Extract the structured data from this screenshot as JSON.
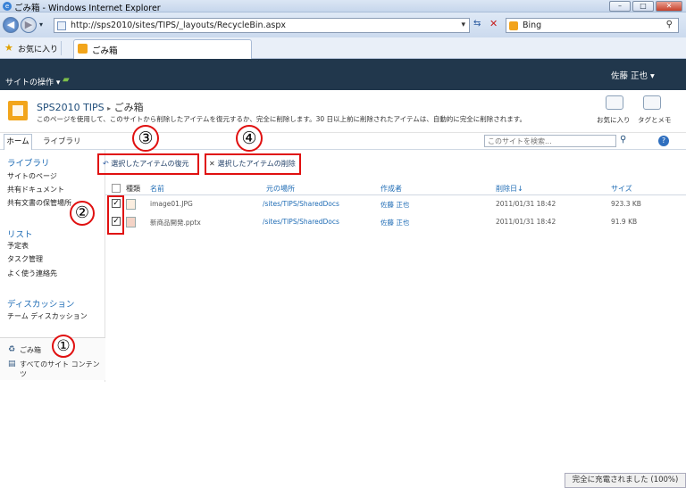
{
  "window": {
    "title": "ごみ箱 - Windows Internet Explorer"
  },
  "addressbar": {
    "url": "http://sps2010/sites/TIPS/_layouts/RecycleBin.aspx",
    "search_engine": "Bing"
  },
  "favorites_bar": {
    "favorites_label": "お気に入り",
    "tab_title": "ごみ箱"
  },
  "sp_header": {
    "site_actions": "サイトの操作",
    "user": "佐藤 正也"
  },
  "title_area": {
    "site_name": "SPS2010 TIPS",
    "page_name": "ごみ箱",
    "description": "このページを使用して、このサイトから削除したアイテムを復元するか、完全に削除します。30 日以上前に削除されたアイテムは、自動的に完全に削除されます。",
    "favorite_label": "お気に入り",
    "tags_label": "タグとメモ"
  },
  "tabs": {
    "home": "ホーム",
    "library": "ライブラリ"
  },
  "search": {
    "placeholder": "このサイトを検索..."
  },
  "left_nav": {
    "libraries_heading": "ライブラリ",
    "libraries": [
      "サイトのページ",
      "共有ドキュメント",
      "共有文書の保管場所"
    ],
    "lists_heading": "リスト",
    "lists": [
      "予定表",
      "タスク管理",
      "よく使う連絡先"
    ],
    "discussions_heading": "ディスカッション",
    "discussions": [
      "チーム ディスカッション"
    ],
    "recycle_bin": "ごみ箱",
    "all_content": "すべてのサイト コンテンツ"
  },
  "toolbar": {
    "restore": "選択したアイテムの復元",
    "delete": "選択したアイテムの削除"
  },
  "columns": {
    "type": "種類",
    "name": "名前",
    "original_location": "元の場所",
    "created_by": "作成者",
    "deleted": "削除日",
    "size": "サイズ"
  },
  "rows": [
    {
      "name": "image01.JPG",
      "location": "/sites/TIPS/SharedDocs",
      "author": "佐藤 正也",
      "deleted": "2011/01/31 18:42",
      "size": "923.3 KB"
    },
    {
      "name": "新商品開発.pptx",
      "location": "/sites/TIPS/SharedDocs",
      "author": "佐藤 正也",
      "deleted": "2011/01/31 18:42",
      "size": "91.9 KB"
    }
  ],
  "annotations": {
    "one": "①",
    "two": "②",
    "three": "③",
    "four": "④"
  },
  "statusbar": {
    "zoom": "完全に充電されました (100%)"
  },
  "colors": {
    "accent_red": "#e01010",
    "link_blue": "#1f6cb5",
    "header_dark": "#21374c"
  }
}
